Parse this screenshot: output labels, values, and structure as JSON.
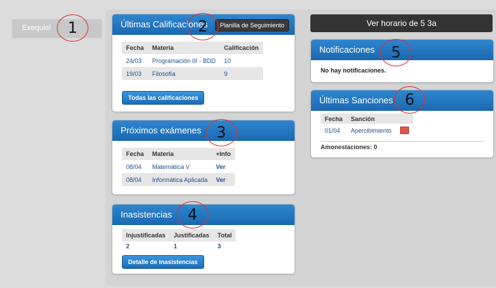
{
  "user": {
    "name": "Exequiel"
  },
  "top_bar": {
    "schedule_label": "Ver horario de 5 3a"
  },
  "grades": {
    "title": "Últimas Calificaciones",
    "tracking_button": "Planilla de Seguimiento",
    "headers": [
      "Fecha",
      "Materia",
      "Calificación"
    ],
    "rows": [
      [
        "24/03",
        "Programación III - BDD",
        "10"
      ],
      [
        "19/03",
        "Filosofía",
        "9"
      ]
    ],
    "all_button": "Todas las calificaciones"
  },
  "exams": {
    "title": "Próximos exámenes",
    "headers": [
      "Fecha",
      "Materia",
      "+Info"
    ],
    "rows": [
      [
        "08/04",
        "Matemática V",
        "Ver"
      ],
      [
        "08/04",
        "Informática Aplicada",
        "Ver"
      ]
    ]
  },
  "absences": {
    "title": "Inasistencias",
    "headers": [
      "Injustificadas",
      "Justificadas",
      "Total"
    ],
    "values": [
      "2",
      "1",
      "3"
    ],
    "detail_button": "Detalle de inasistencias"
  },
  "notifications": {
    "title": "Notificaciones",
    "empty_text": "No hay notificaciones."
  },
  "sanctions": {
    "title": "Últimas Sanciones",
    "headers": [
      "Fecha",
      "Sanción",
      ""
    ],
    "rows": [
      [
        "01/04",
        "Apercibimiento",
        "note-icon"
      ]
    ],
    "amonestaciones": "Amonestaciones: 0"
  },
  "markers": [
    "1",
    "2",
    "3",
    "4",
    "5",
    "6"
  ]
}
